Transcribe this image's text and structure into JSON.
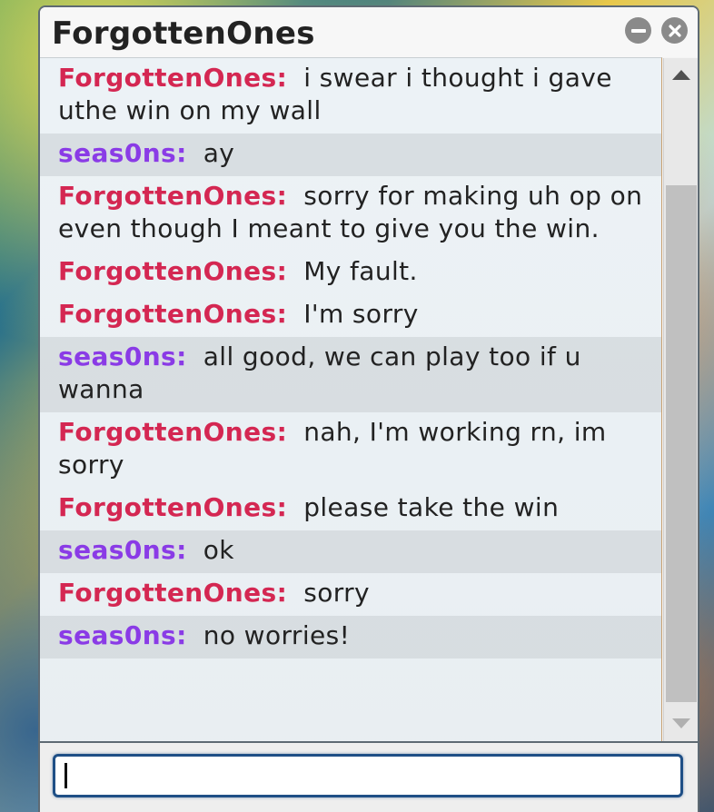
{
  "window": {
    "title": "ForgottenOnes"
  },
  "messages": [
    {
      "user": "ForgottenOnes:",
      "text": "i swear i thought i gave uthe win on my wall",
      "alt": false
    },
    {
      "user": "seas0ns:",
      "text": "ay",
      "alt": true
    },
    {
      "user": "ForgottenOnes:",
      "text": "sorry for making uh op on even though I meant to give you the win.",
      "alt": false
    },
    {
      "user": "ForgottenOnes:",
      "text": "My fault.",
      "alt": false
    },
    {
      "user": "ForgottenOnes:",
      "text": "I'm sorry",
      "alt": false
    },
    {
      "user": "seas0ns:",
      "text": "all good, we can play too if u wanna",
      "alt": true
    },
    {
      "user": "ForgottenOnes:",
      "text": "nah, I'm working rn, im sorry",
      "alt": false
    },
    {
      "user": "ForgottenOnes:",
      "text": "please take the win",
      "alt": false
    },
    {
      "user": "seas0ns:",
      "text": "ok",
      "alt": true
    },
    {
      "user": "ForgottenOnes:",
      "text": "sorry",
      "alt": false
    },
    {
      "user": "seas0ns:",
      "text": "no worries!",
      "alt": true
    }
  ],
  "input": {
    "value": "",
    "placeholder": ""
  },
  "icons": {
    "minimize": "minimize-icon",
    "close": "close-icon",
    "scroll_up": "scroll-up-arrow-icon",
    "scroll_down": "scroll-down-arrow-icon"
  },
  "colors": {
    "user_forgottenones": "#d42752",
    "user_seas0ns": "#8a3be6",
    "input_border": "#1f4f86",
    "titlebar_icon": "#8a8a8a"
  }
}
